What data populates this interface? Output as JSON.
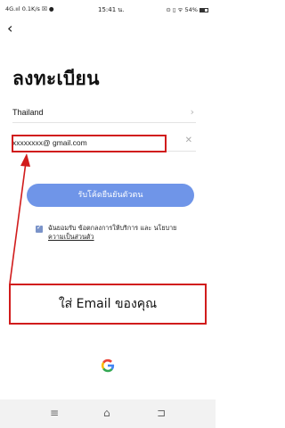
{
  "status_bar": {
    "left": "4G.ııl 0.1K/s ☒ ●",
    "time": "15:41 น.",
    "right": "⊙ ▯ ᯤ 54%"
  },
  "header": {
    "back_icon": "chevron-left-icon"
  },
  "title": "ลงทะเบียน",
  "country": {
    "value": "Thailand",
    "icon": "chevron-right-icon"
  },
  "email": {
    "value": "xxxxxxxx@ gmail.com",
    "clear_icon": "close-icon"
  },
  "get_code_button": "รับโค้ดยืนยันตัวตน",
  "consent": {
    "prefix": "ฉันยอมรับ ข้อตกลงการให้บริการ และ นโยบาย",
    "link": "ความเป็นส่วนตัว",
    "checked": true
  },
  "callout": "ใส่ Email ของคุณ",
  "social": {
    "google_icon": "google-icon"
  },
  "nav_bar": {
    "menu": "≡",
    "home": "⌂",
    "back": "⊐"
  },
  "colors": {
    "accent": "#6f95e8",
    "annotation": "#d11c1c"
  }
}
